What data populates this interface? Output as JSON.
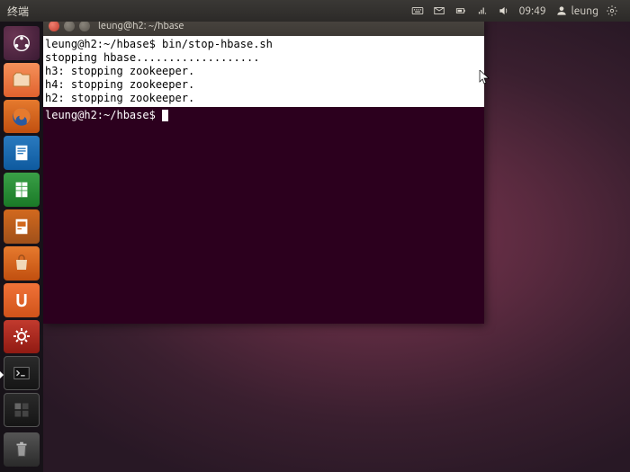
{
  "panel": {
    "app": "终端",
    "time": "09:49",
    "user": "leung"
  },
  "launcher": [
    {
      "name": "dash",
      "label": "Dash"
    },
    {
      "name": "files",
      "label": "Files"
    },
    {
      "name": "firefox",
      "label": "Firefox"
    },
    {
      "name": "writer",
      "label": "Writer"
    },
    {
      "name": "calc",
      "label": "Calc"
    },
    {
      "name": "impress",
      "label": "Impress"
    },
    {
      "name": "usc",
      "label": "Software Center"
    },
    {
      "name": "uone",
      "label": "Ubuntu One"
    },
    {
      "name": "settings",
      "label": "Settings"
    },
    {
      "name": "terminal",
      "label": "Terminal"
    },
    {
      "name": "ws",
      "label": "Workspace Switcher"
    }
  ],
  "trash": "Trash",
  "window": {
    "title": "leung@h2: ~/hbase"
  },
  "terminal": {
    "prompt1": "leung@h2:~/hbase$ ",
    "cmd1": "bin/stop-hbase.sh",
    "line2": "stopping hbase...................",
    "line3": "h3: stopping zookeeper.",
    "line4": "h4: stopping zookeeper.",
    "line5": "h2: stopping zookeeper.",
    "prompt2": "leung@h2:~/hbase$ "
  }
}
